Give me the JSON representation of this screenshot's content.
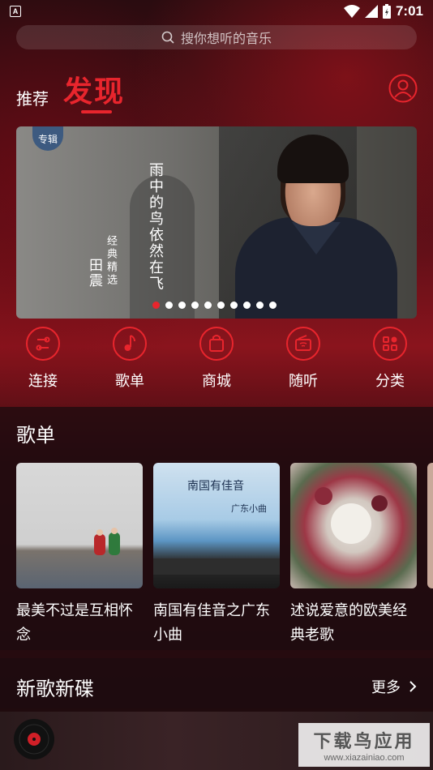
{
  "status_bar": {
    "time": "7:01",
    "badge": "A"
  },
  "search": {
    "placeholder": "搜你想听的音乐"
  },
  "header": {
    "tab_recommend": "推荐",
    "tab_discover": "发现"
  },
  "banner": {
    "tag": "专辑",
    "title": "雨中的鸟依然在飞",
    "subtitle": "经典精选",
    "artist": "田震",
    "dots_count": 10,
    "active_dot": 0
  },
  "shortcuts": [
    {
      "label": "连接",
      "icon": "link-icon"
    },
    {
      "label": "歌单",
      "icon": "music-note-icon"
    },
    {
      "label": "商城",
      "icon": "shopping-bag-icon"
    },
    {
      "label": "随听",
      "icon": "radio-icon"
    },
    {
      "label": "分类",
      "icon": "category-icon"
    }
  ],
  "playlists": {
    "title": "歌单",
    "items": [
      {
        "title": "最美不过是互相怀念"
      },
      {
        "title": "南国有佳音之广东小曲",
        "img_text_1": "南国有佳音",
        "img_text_2": "广东小曲"
      },
      {
        "title": "述说爱意的欧美经典老歌"
      }
    ]
  },
  "new_releases": {
    "title": "新歌新碟",
    "more_label": "更多"
  },
  "watermark": {
    "line1": "下载鸟应用",
    "line2": "www.xiazainiao.com"
  },
  "colors": {
    "accent": "#e8252d",
    "background": "#120b0d"
  }
}
